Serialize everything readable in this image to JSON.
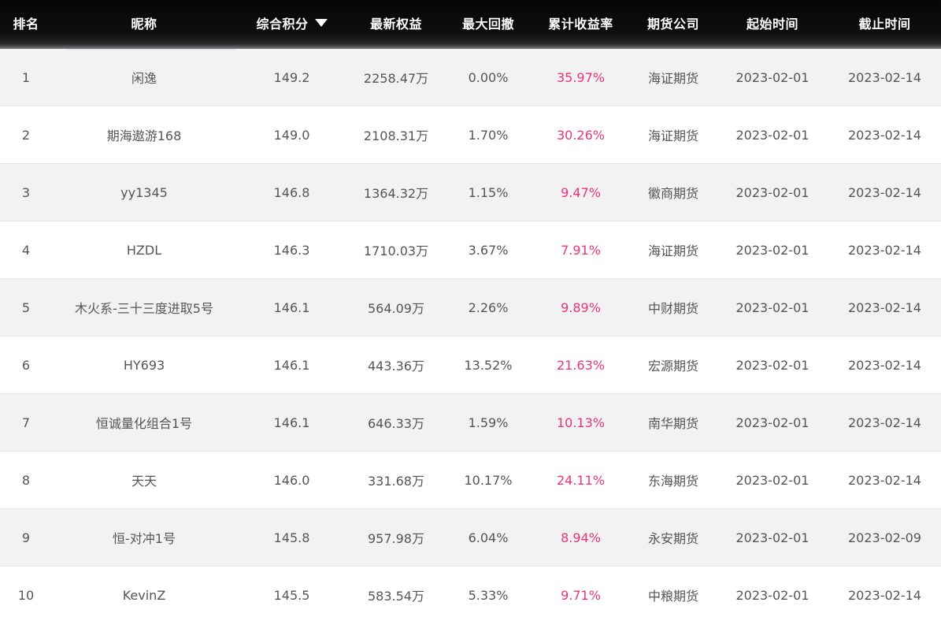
{
  "headers": {
    "rank": "排名",
    "nickname": "昵称",
    "score": "综合积分",
    "equity": "最新权益",
    "max_drawdown": "最大回撤",
    "cumulative_return": "累计收益率",
    "company": "期货公司",
    "start_date": "起始时间",
    "end_date": "截止时间"
  },
  "sort": {
    "column": "score",
    "direction": "desc",
    "icon": "caret-down-icon"
  },
  "colors": {
    "header_bg": "#0a0a0a",
    "header_text": "#ffffff",
    "row_alt_bg": "#f2f2f2",
    "text": "#555555",
    "return_text": "#e8347a"
  },
  "rows": [
    {
      "rank": "1",
      "nickname": "闲逸",
      "score": "149.2",
      "equity": "2258.47万",
      "max_drawdown": "0.00%",
      "cumulative_return": "35.97%",
      "company": "海证期货",
      "start_date": "2023-02-01",
      "end_date": "2023-02-14"
    },
    {
      "rank": "2",
      "nickname": "期海遨游168",
      "score": "149.0",
      "equity": "2108.31万",
      "max_drawdown": "1.70%",
      "cumulative_return": "30.26%",
      "company": "海证期货",
      "start_date": "2023-02-01",
      "end_date": "2023-02-14"
    },
    {
      "rank": "3",
      "nickname": "yy1345",
      "score": "146.8",
      "equity": "1364.32万",
      "max_drawdown": "1.15%",
      "cumulative_return": "9.47%",
      "company": "徽商期货",
      "start_date": "2023-02-01",
      "end_date": "2023-02-14"
    },
    {
      "rank": "4",
      "nickname": "HZDL",
      "score": "146.3",
      "equity": "1710.03万",
      "max_drawdown": "3.67%",
      "cumulative_return": "7.91%",
      "company": "海证期货",
      "start_date": "2023-02-01",
      "end_date": "2023-02-14"
    },
    {
      "rank": "5",
      "nickname": "木火系-三十三度进取5号",
      "score": "146.1",
      "equity": "564.09万",
      "max_drawdown": "2.26%",
      "cumulative_return": "9.89%",
      "company": "中财期货",
      "start_date": "2023-02-01",
      "end_date": "2023-02-14"
    },
    {
      "rank": "6",
      "nickname": "HY693",
      "score": "146.1",
      "equity": "443.36万",
      "max_drawdown": "13.52%",
      "cumulative_return": "21.63%",
      "company": "宏源期货",
      "start_date": "2023-02-01",
      "end_date": "2023-02-14"
    },
    {
      "rank": "7",
      "nickname": "恒诚量化组合1号",
      "score": "146.1",
      "equity": "646.33万",
      "max_drawdown": "1.59%",
      "cumulative_return": "10.13%",
      "company": "南华期货",
      "start_date": "2023-02-01",
      "end_date": "2023-02-14"
    },
    {
      "rank": "8",
      "nickname": "天天",
      "score": "146.0",
      "equity": "331.68万",
      "max_drawdown": "10.17%",
      "cumulative_return": "24.11%",
      "company": "东海期货",
      "start_date": "2023-02-01",
      "end_date": "2023-02-14"
    },
    {
      "rank": "9",
      "nickname": "恒-对冲1号",
      "score": "145.8",
      "equity": "957.98万",
      "max_drawdown": "6.04%",
      "cumulative_return": "8.94%",
      "company": "永安期货",
      "start_date": "2023-02-01",
      "end_date": "2023-02-09"
    },
    {
      "rank": "10",
      "nickname": "KevinZ",
      "score": "145.5",
      "equity": "583.54万",
      "max_drawdown": "5.33%",
      "cumulative_return": "9.71%",
      "company": "中粮期货",
      "start_date": "2023-02-01",
      "end_date": "2023-02-14"
    }
  ]
}
